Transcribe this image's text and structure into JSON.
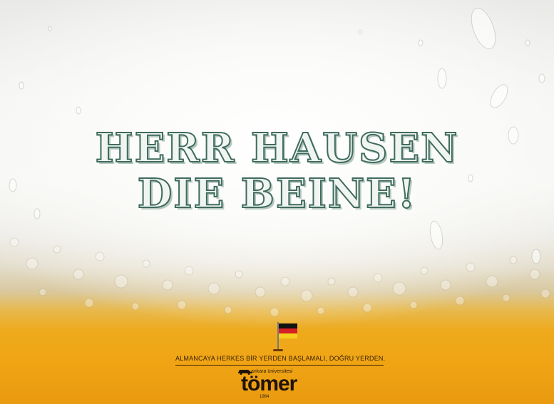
{
  "headline": {
    "line1": "HERR HAUSEN",
    "line2": "DIE BEINE!"
  },
  "slogan": "ALMANCAYA HERKES BİR YERDEN BAŞLAMALI, DOĞRU YERDEN.",
  "logo": {
    "subtitle": "ankara üniversitesi",
    "wordmark": "tömer",
    "year": "1984"
  },
  "icons": [
    "germany-flag-icon",
    "car-icon"
  ],
  "colors": {
    "headline_outline": "#3f6b5e",
    "beer": "#f0a414",
    "foam": "#f6f6f4",
    "text_dark": "#3a2206"
  }
}
